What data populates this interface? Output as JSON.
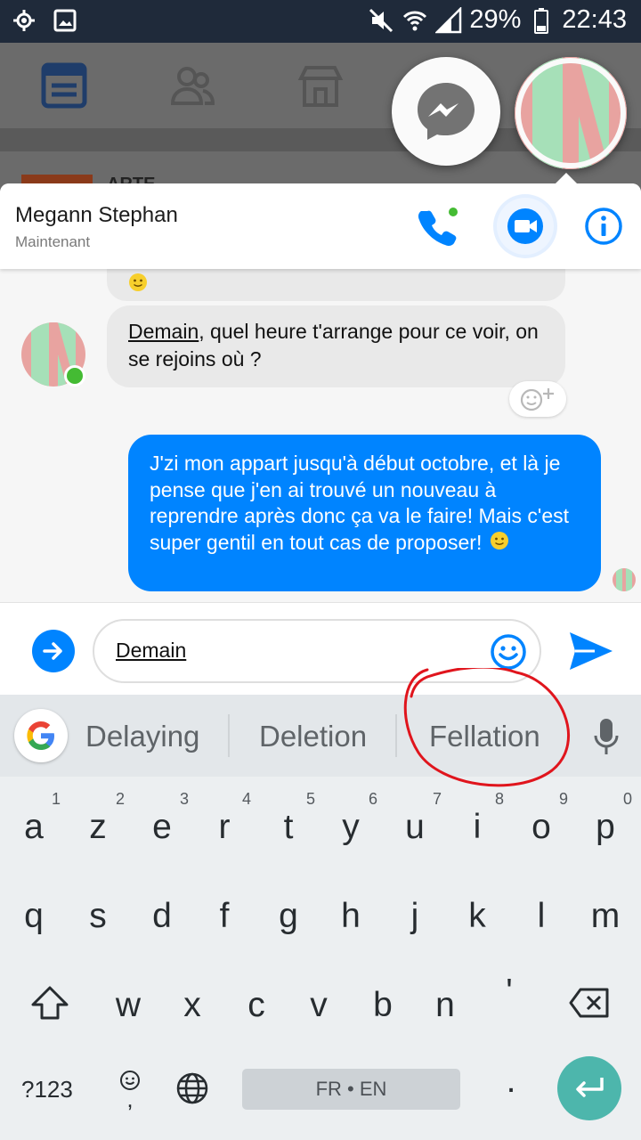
{
  "status_bar": {
    "battery_percent": "29%",
    "time": "22:43",
    "icons": [
      "location-icon",
      "image-icon",
      "mute-icon",
      "wifi-icon",
      "signal-icon",
      "battery-icon"
    ]
  },
  "background_app": {
    "story_text": "ARTE"
  },
  "chat": {
    "contact_name": "Megann Stephan",
    "contact_status": "Maintenant",
    "messages": [
      {
        "direction": "incoming",
        "text_underlined": "Demain",
        "text_rest": ", quel heure t'arrange pour ce voir, on se rejoins où ?"
      },
      {
        "direction": "outgoing",
        "text": "J'zi mon appart jusqu'à début octobre, et là je pense que j'en ai trouvé un nouveau à reprendre après donc ça va le faire! Mais c'est super gentil en tout cas de proposer!"
      }
    ],
    "composer_value": "Demain"
  },
  "keyboard": {
    "suggestions": [
      "Delaying",
      "Deletion",
      "Fellation"
    ],
    "row1": [
      {
        "key": "a",
        "hint": "1"
      },
      {
        "key": "z",
        "hint": "2"
      },
      {
        "key": "e",
        "hint": "3"
      },
      {
        "key": "r",
        "hint": "4"
      },
      {
        "key": "t",
        "hint": "5"
      },
      {
        "key": "y",
        "hint": "6"
      },
      {
        "key": "u",
        "hint": "7"
      },
      {
        "key": "i",
        "hint": "8"
      },
      {
        "key": "o",
        "hint": "9"
      },
      {
        "key": "p",
        "hint": "0"
      }
    ],
    "row2": [
      "q",
      "s",
      "d",
      "f",
      "g",
      "h",
      "j",
      "k",
      "l",
      "m"
    ],
    "row3": [
      "w",
      "x",
      "c",
      "v",
      "b",
      "n",
      "'"
    ],
    "numbers_key": "?123",
    "comma_key": ",",
    "period_key": ".",
    "space_label": "FR • EN"
  },
  "colors": {
    "messenger_blue": "#0084ff",
    "online_green": "#44bb33",
    "enter_teal": "#4db6ac",
    "annotation_red": "#e0151d"
  }
}
